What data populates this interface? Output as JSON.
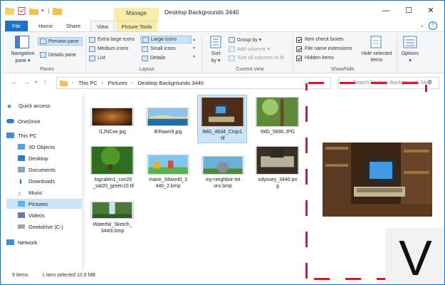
{
  "window": {
    "title": "Desktop Backgrounds 3440",
    "manage_label": "Manage",
    "controls": {
      "minimize": "—",
      "maximize": "☐",
      "close": "✕"
    }
  },
  "tabs": [
    {
      "label": "File"
    },
    {
      "label": "Home"
    },
    {
      "label": "Share"
    },
    {
      "label": "View"
    },
    {
      "label": "Picture Tools"
    }
  ],
  "ribbon": {
    "panes": {
      "navigation_pane": "Navigation",
      "navigation_pane2": "pane ▾",
      "preview_pane": "Preview pane",
      "details_pane": "Details pane",
      "label": "Panes"
    },
    "layout": {
      "extra_large_icons": "Extra large icons",
      "large_icons": "Large icons",
      "medium_icons": "Medium icons",
      "small_icons": "Small icons",
      "list": "List",
      "details": "Details",
      "label": "Layout"
    },
    "current_view": {
      "sort_by": "Sort",
      "sort_by2": "by ▾",
      "group_by": "Group by ▾",
      "add_columns": "Add columns ▾",
      "size_columns": "Size all columns to fit",
      "label": "Current view"
    },
    "show_hide": {
      "item_check_boxes": "Item check boxes",
      "file_name_extensions": "File name extensions",
      "hidden_items": "Hidden items",
      "hide_selected": "Hide selected",
      "hide_selected2": "items",
      "label": "Show/hide"
    },
    "options": {
      "label": "Options",
      "label2": "▾"
    }
  },
  "address": {
    "crumbs": [
      "This PC",
      "Pictures",
      "Desktop Backgrounds 3440"
    ],
    "search_placeholder": "Search Desktop Backgrounds 3440"
  },
  "nav": {
    "items": [
      {
        "label": "Quick access",
        "icon": "star-icon"
      },
      {
        "label": "OneDrive",
        "icon": "cloud-icon"
      },
      {
        "label": "This PC",
        "icon": "computer-icon"
      },
      {
        "label": "3D Objects",
        "icon": "cube-icon"
      },
      {
        "label": "Desktop",
        "icon": "desktop-icon"
      },
      {
        "label": "Documents",
        "icon": "document-icon"
      },
      {
        "label": "Downloads",
        "icon": "download-icon"
      },
      {
        "label": "Music",
        "icon": "music-icon"
      },
      {
        "label": "Pictures",
        "icon": "pictures-icon"
      },
      {
        "label": "Videos",
        "icon": "video-icon"
      },
      {
        "label": "Geekdrive (C:)",
        "icon": "drive-icon"
      },
      {
        "label": "Network",
        "icon": "network-icon"
      }
    ]
  },
  "files": [
    {
      "name1": "l1JNCxe.jpg",
      "name2": ""
    },
    {
      "name1": "iERawn9.jpg",
      "name2": ""
    },
    {
      "name1": "IMG_4634_Crop1.",
      "name2": "tif"
    },
    {
      "name1": "IMG_5690.JPG",
      "name2": ""
    },
    {
      "name1": "logcabin1_con20",
      "name2": "_sat20_green10.tif"
    },
    {
      "name1": "mario_3dworld_3",
      "name2": "440_2.bmp"
    },
    {
      "name1": "my-neighbor-tot",
      "name2": "oro.bmp"
    },
    {
      "name1": "odyssey_3440.pn",
      "name2": "g"
    },
    {
      "name1": "Waterfal_Sketch_",
      "name2": "3440l.bmp"
    }
  ],
  "status": {
    "count": "9 items",
    "selected": "1 item selected  10.9 MB"
  },
  "colors": {
    "accent": "#1a73c8",
    "picture_tools": "#f7eca8",
    "dashed_border": "#e8102a",
    "selection": "#cce4f7"
  },
  "logo": {
    "letter": "V"
  }
}
